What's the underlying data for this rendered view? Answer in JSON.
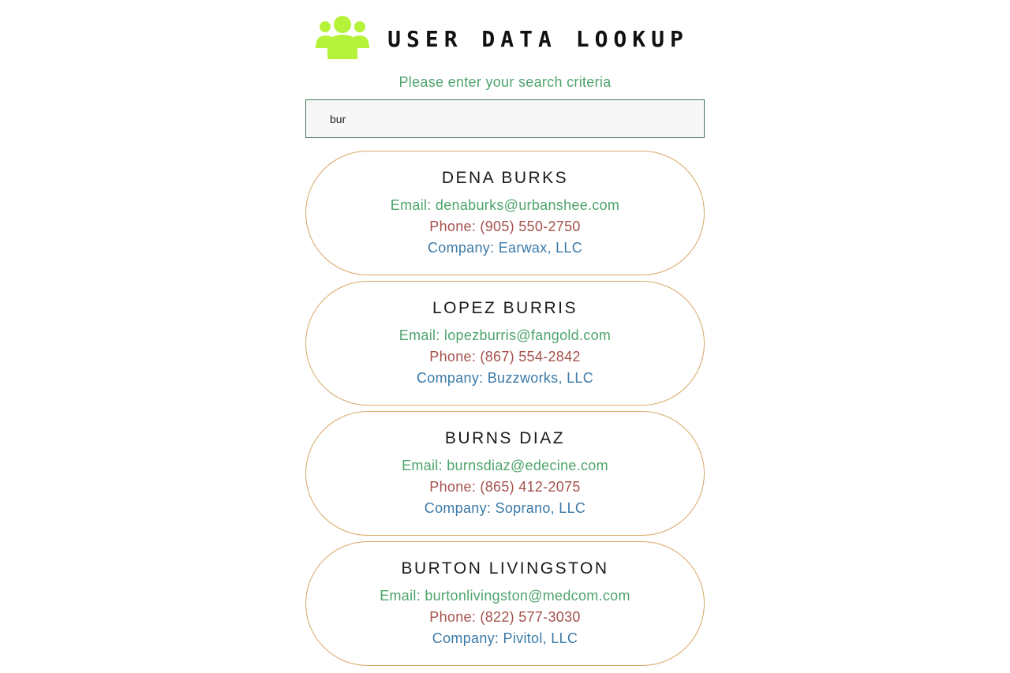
{
  "header": {
    "logo_icon": "users-group-icon",
    "logo_color": "#b5f23a",
    "title": "USER DATA LOOKUP"
  },
  "search": {
    "prompt": "Please enter your search criteria",
    "value": "bur"
  },
  "labels": {
    "email": "Email: ",
    "phone": "Phone: ",
    "company": "Company: "
  },
  "results": [
    {
      "name": "DENA BURKS",
      "email": "denaburks@urbanshee.com",
      "phone": "(905) 550-2750",
      "company": "Earwax, LLC"
    },
    {
      "name": "LOPEZ BURRIS",
      "email": "lopezburris@fangold.com",
      "phone": "(867) 554-2842",
      "company": "Buzzworks, LLC"
    },
    {
      "name": "BURNS DIAZ",
      "email": "burnsdiaz@edecine.com",
      "phone": "(865) 412-2075",
      "company": "Soprano, LLC"
    },
    {
      "name": "BURTON LIVINGSTON",
      "email": "burtonlivingston@medcom.com",
      "phone": "(822) 577-3030",
      "company": "Pivitol, LLC"
    }
  ],
  "colors": {
    "email": "#4ea46c",
    "phone": "#a5524c",
    "company": "#3b7aa8",
    "card_border": "#d8a867",
    "input_border": "#3f7a55"
  }
}
